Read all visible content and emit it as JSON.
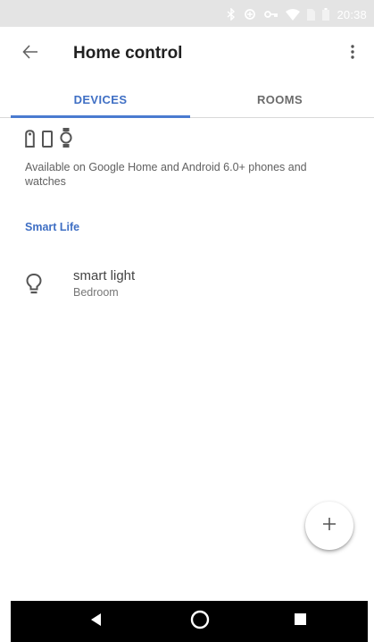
{
  "status_bar": {
    "time": "20:38",
    "icons": [
      "bluetooth-icon",
      "data-saver-icon",
      "vpn-key-icon",
      "wifi-icon",
      "sim-icon",
      "battery-icon"
    ]
  },
  "app_bar": {
    "title": "Home control",
    "back_icon": "arrow-back-icon",
    "overflow_icon": "more-vert-icon"
  },
  "tabs": [
    {
      "label": "DEVICES",
      "selected": true
    },
    {
      "label": "ROOMS",
      "selected": false
    }
  ],
  "availability": {
    "device_icons": [
      "speaker-icon",
      "phone-icon",
      "watch-icon"
    ],
    "text": "Available on Google Home and Android 6.0+ phones and watches"
  },
  "section": {
    "title": "Smart Life"
  },
  "devices": [
    {
      "name": "smart light",
      "room": "Bedroom",
      "icon": "lightbulb-icon"
    }
  ],
  "fab": {
    "icon": "add-icon"
  },
  "nav_bar": {
    "icons": [
      "nav-back-icon",
      "nav-home-icon",
      "nav-recents-icon"
    ]
  },
  "colors": {
    "accent": "#3f6fc4",
    "status_bar": "#e4e4e4",
    "nav_bar": "#000000"
  }
}
